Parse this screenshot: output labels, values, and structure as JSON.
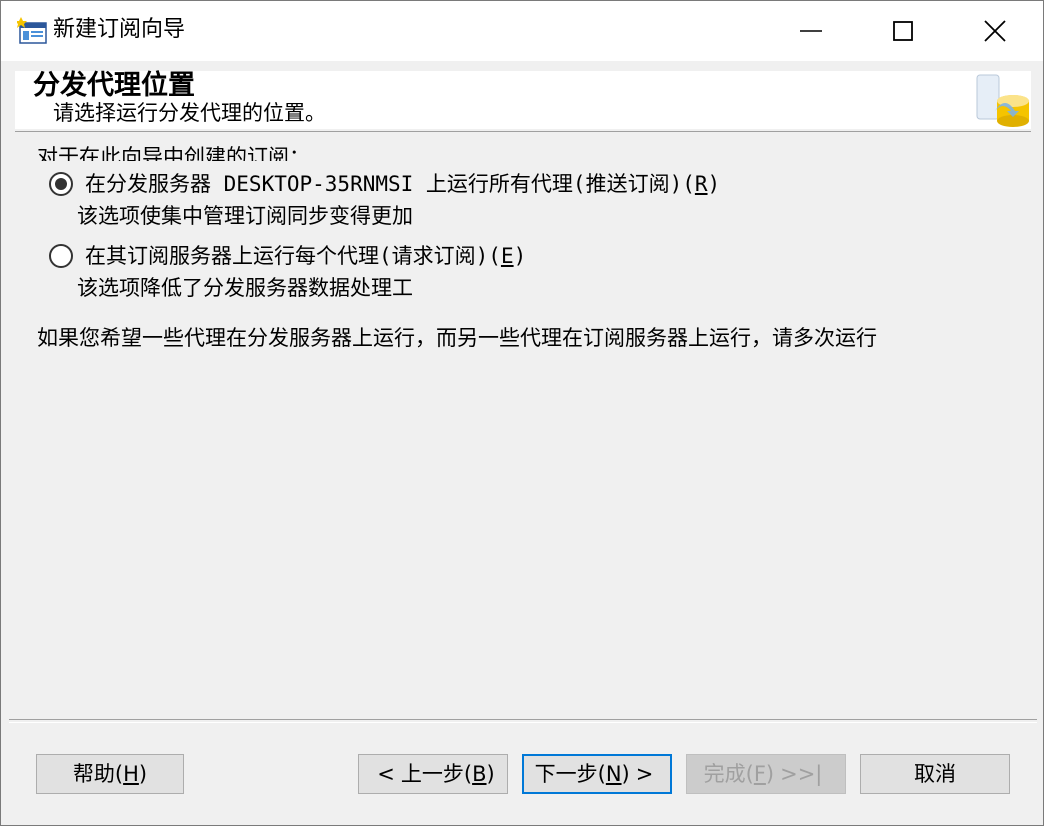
{
  "window": {
    "title": "新建订阅向导",
    "icon": "wizard-app-icon"
  },
  "header": {
    "title": "分发代理位置",
    "subtitle": "请选择运行分发代理的位置。",
    "graphic": "database-server-icon"
  },
  "main": {
    "intro": "对于在此向导中创建的订阅：",
    "options": [
      {
        "label": "在分发服务器 DESKTOP-35RNMSI 上运行所有代理(推送订阅)(",
        "mnemonic": "R",
        "label_end": ")",
        "description": "该选项使集中管理订阅同步变得更加",
        "selected": true
      },
      {
        "label": "在其订阅服务器上运行每个代理(请求订阅)(",
        "mnemonic": "E",
        "label_end": ")",
        "description": "该选项降低了分发服务器数据处理工",
        "selected": false
      }
    ],
    "note": "如果您希望一些代理在分发服务器上运行，而另一些代理在订阅服务器上运行，请多次运行"
  },
  "buttons": {
    "help": {
      "text": "帮助(",
      "mnemonic": "H",
      "end": ")"
    },
    "back": {
      "arrow": "<",
      "text": "上一步(",
      "mnemonic": "B",
      "end": ")"
    },
    "next": {
      "text": "下一步(",
      "mnemonic": "N",
      "end": ")",
      "arrow": ">"
    },
    "finish": {
      "text": "完成(",
      "mnemonic": "F",
      "end": ")",
      "arrow": ">>|",
      "enabled": false
    },
    "cancel": {
      "text": "取消"
    }
  },
  "colors": {
    "focus_border": "#0078d7",
    "disabled_text": "#a0a0a0"
  }
}
